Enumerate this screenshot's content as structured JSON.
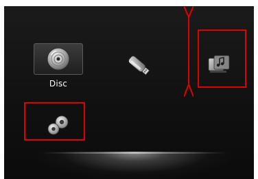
{
  "menu": {
    "items": [
      {
        "id": "disc",
        "label": "Disc",
        "icon": "disc-icon",
        "selected": true
      },
      {
        "id": "usb",
        "label": "",
        "icon": "usb-drive-icon"
      },
      {
        "id": "media",
        "label": "",
        "icon": "media-library-icon"
      },
      {
        "id": "setup",
        "label": "",
        "icon": "settings-gears-icon"
      }
    ]
  },
  "annotations": {
    "highlight_color": "#e00000",
    "highlighted_items": [
      "media",
      "setup"
    ]
  },
  "colors": {
    "background": "#111111",
    "label_text": "#ffffff"
  }
}
